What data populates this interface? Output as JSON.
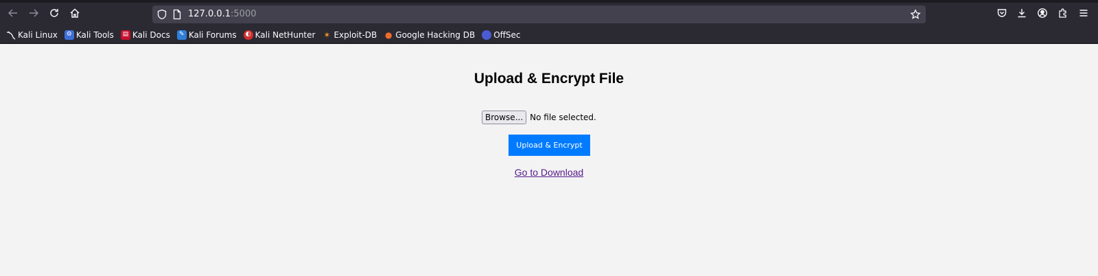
{
  "browser": {
    "url_host": "127.0.0.1",
    "url_port": ":5000",
    "icons": {
      "back": "arrow-left-icon",
      "forward": "arrow-right-icon",
      "reload": "reload-icon",
      "home": "home-icon",
      "tracking_protection": "shield-icon",
      "page_info": "page-icon",
      "bookmark_star": "star-icon",
      "pocket": "pocket-icon",
      "downloads": "download-icon",
      "account": "account-icon",
      "extensions": "puzzle-icon",
      "menu": "hamburger-menu-icon"
    },
    "colors": {
      "toolbar": "#2b2a33",
      "urlbar": "#42414d"
    }
  },
  "bookmarks": [
    {
      "label": "Kali Linux",
      "icon": "kali-dragon-icon"
    },
    {
      "label": "Kali Tools",
      "icon": "kali-tools-icon"
    },
    {
      "label": "Kali Docs",
      "icon": "kali-docs-icon"
    },
    {
      "label": "Kali Forums",
      "icon": "kali-forums-icon"
    },
    {
      "label": "Kali NetHunter",
      "icon": "nethunter-icon"
    },
    {
      "label": "Exploit-DB",
      "icon": "exploit-db-icon"
    },
    {
      "label": "Google Hacking DB",
      "icon": "ghdb-icon"
    },
    {
      "label": "OffSec",
      "icon": "offsec-icon"
    }
  ],
  "page": {
    "title": "Upload & Encrypt File",
    "browse_label": "Browse...",
    "file_status": "No file selected.",
    "submit_label": "Upload & Encrypt",
    "download_link": "Go to Download",
    "colors": {
      "background": "#f3f3f3",
      "button": "#007bff",
      "link": "#551a8b"
    }
  }
}
